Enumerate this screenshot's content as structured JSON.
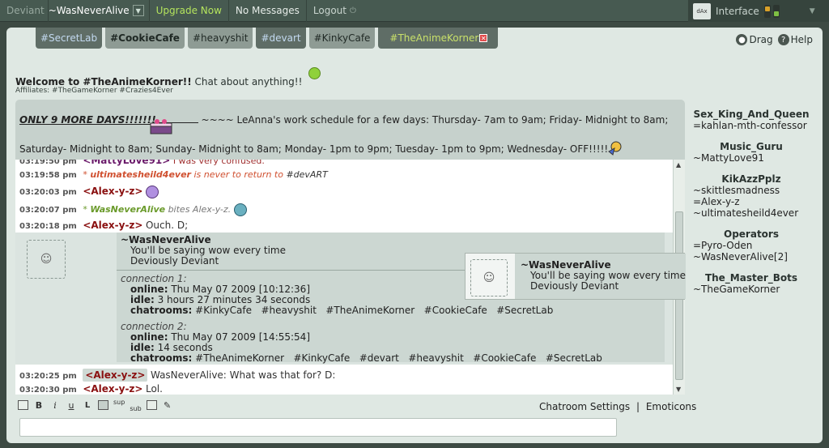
{
  "topbar": {
    "brand": "Deviant",
    "username": "~WasNeverAlive",
    "upgrade": "Upgrade Now",
    "messages": "No Messages",
    "logout": "Logout",
    "interface": "Interface",
    "box_icon_text": "dAx"
  },
  "tabs": [
    {
      "label": "#SecretLab"
    },
    {
      "label": "#CookieCafe"
    },
    {
      "label": "#heavyshit"
    },
    {
      "label": "#devart"
    },
    {
      "label": "#KinkyCafe"
    },
    {
      "label": "#TheAnimeKorner"
    }
  ],
  "controls": {
    "drag": "Drag",
    "help": "Help"
  },
  "room": {
    "welcome_bold": "Welcome to #TheAnimeKorner!!",
    "welcome_rest": "Chat about anything!!",
    "affiliates": "Affiliates: #TheGameKorner #Crazies4Ever"
  },
  "topic": {
    "bold": "ONLY 9 MORE DAYS!!!!!!!",
    "line1_rest": "~~~~ LeAnna's work schedule for a few days: Thursday- 7am to 9am; Friday- Midnight to 8am;",
    "line2": "Saturday- Midnight to 8am; Sunday- Midnight to 8am; Monday- 1pm to 9pm; Tuesday- 1pm to 9pm; Wednesday- OFF!!!!!"
  },
  "log": {
    "m0": {
      "ts": "03:19:50 pm",
      "nick": "<MattyLove91>",
      "text": "I was very confused."
    },
    "m1": {
      "ts": "03:19:58 pm",
      "star": "*",
      "nick": "ultimatesheild4ever",
      "text": "is never to return to",
      "room": "#devART"
    },
    "m2": {
      "ts": "03:20:03 pm",
      "nick": "<Alex-y-z>"
    },
    "m3": {
      "ts": "03:20:07 pm",
      "star": "*",
      "nick": "WasNeverAlive",
      "text": "bites Alex-y-z."
    },
    "m4": {
      "ts": "03:20:18 pm",
      "nick": "<Alex-y-z>",
      "text": "Ouch. D;"
    },
    "m5": {
      "ts": "03:20:25 pm",
      "nick": "<Alex-y-z>",
      "text": "WasNeverAlive: What was that for? D:"
    },
    "m6": {
      "ts": "03:20:30 pm",
      "nick": "<Alex-y-z>",
      "text": "Lol."
    }
  },
  "whois": {
    "name": "~WasNeverAlive",
    "line1": "You'll be saying wow every time",
    "line2": "Deviously Deviant",
    "c1_title": "connection 1:",
    "c1_online_label": "online:",
    "c1_online": "Thu May 07 2009 [10:12:36]",
    "c1_idle_label": "idle:",
    "c1_idle": "3 hours 27 minutes 34 seconds",
    "c1_rooms_label": "chatrooms:",
    "c1_rooms": "#KinkyCafe   #heavyshit   #TheAnimeKorner   #CookieCafe   #SecretLab",
    "c2_title": "connection 2:",
    "c2_online_label": "online:",
    "c2_online": "Thu May 07 2009 [14:55:54]",
    "c2_idle_label": "idle:",
    "c2_idle": "14 seconds",
    "c2_rooms_label": "chatrooms:",
    "c2_rooms": "#TheAnimeKorner   #KinkyCafe   #devart   #heavyshit   #CookieCafe   #SecretLab"
  },
  "popup": {
    "name": "~WasNeverAlive",
    "line1": "You'll be saying wow every time",
    "line2": "Deviously Deviant"
  },
  "toolbar": {
    "bold": "B",
    "italic": "i",
    "underline": "u",
    "l": "L",
    "sup": "sup",
    "sub": "sub",
    "settings": "Chatroom Settings",
    "sep": "|",
    "emoticons": "Emoticons"
  },
  "userlist": [
    {
      "title": "Sex_King_And_Queen",
      "members": [
        "=kahlan-mth-confessor"
      ]
    },
    {
      "title": "Music_Guru",
      "members": [
        "~MattyLove91"
      ]
    },
    {
      "title": "KikAzzPplz",
      "members": [
        "~skittlesmadness",
        "=Alex-y-z",
        "~ultimatesheild4ever"
      ]
    },
    {
      "title": "Operators",
      "members": [
        "=Pyro-Oden",
        "~WasNeverAlive[2]"
      ]
    },
    {
      "title": "The_Master_Bots",
      "members": [
        "~TheGameKorner"
      ]
    }
  ],
  "colors": {
    "accent_green": "#b4e45d",
    "nick_red": "#8a1010",
    "action_orange": "#d05030",
    "action_green": "#6a9a2a"
  }
}
